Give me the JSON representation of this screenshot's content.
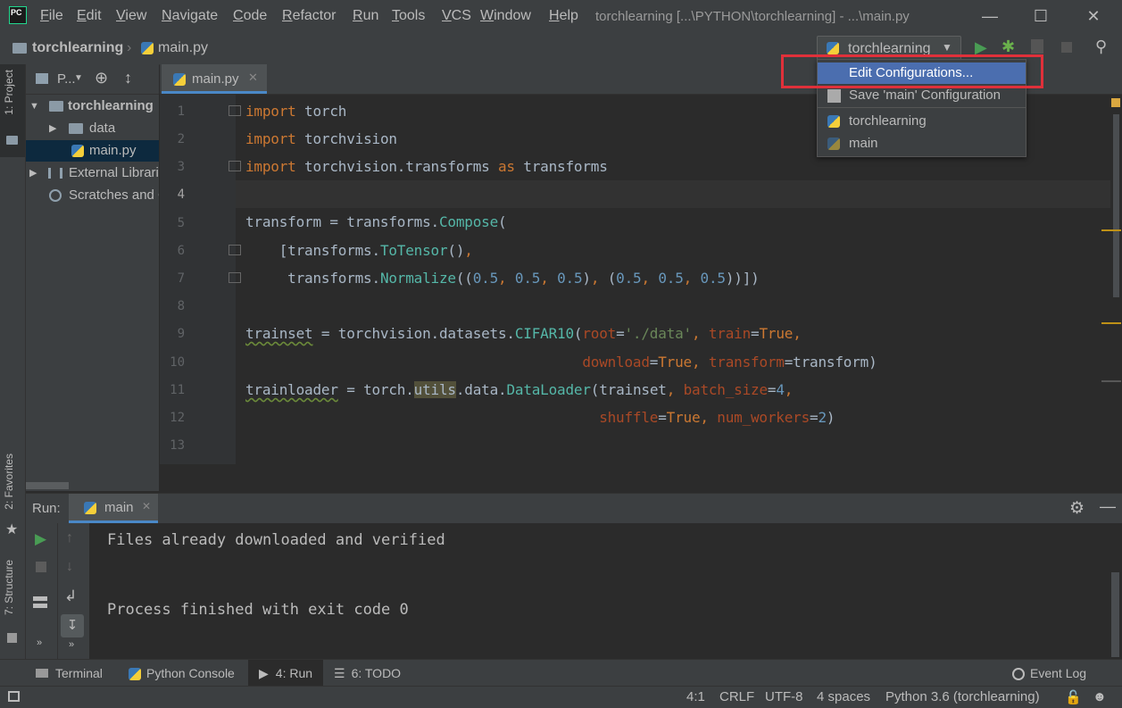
{
  "menu": {
    "items": [
      "File",
      "Edit",
      "View",
      "Navigate",
      "Code",
      "Refactor",
      "Run",
      "Tools",
      "VCS",
      "Window",
      "Help"
    ],
    "window_title": "torchlearning [...\\PYTHON\\torchlearning] - ...\\main.py"
  },
  "navbar": {
    "project": "torchlearning",
    "file": "main.py",
    "run_config": "torchlearning"
  },
  "project_panel": {
    "header": "P...",
    "tree": [
      "torchlearning",
      "data",
      "main.py",
      "External Libraries",
      "Scratches and Consoles"
    ]
  },
  "left_strip": {
    "project": "1: Project",
    "favorites": "2: Favorites",
    "structure": "7: Structure"
  },
  "editor": {
    "tab": "main.py",
    "line_numbers": [
      "1",
      "2",
      "3",
      "4",
      "5",
      "6",
      "7",
      "8",
      "9",
      "10",
      "11",
      "12",
      "13"
    ]
  },
  "popup": {
    "items": [
      "Edit Configurations...",
      "Save 'main' Configuration",
      "torchlearning",
      "main"
    ]
  },
  "run": {
    "label": "Run:",
    "tab": "main",
    "output": [
      "Files already downloaded and verified",
      "",
      "Process finished with exit code 0"
    ]
  },
  "bottom_tabs": [
    "Terminal",
    "Python Console",
    "4: Run",
    "6: TODO",
    "Event Log"
  ],
  "status": {
    "position": "4:1",
    "line_sep": "CRLF",
    "encoding": "UTF-8",
    "indent": "4 spaces",
    "interpreter": "Python 3.6 (torchlearning)"
  },
  "colors": {
    "accent": "#4b6eaf",
    "highlight": "#e0303a",
    "run_green": "#499c54"
  }
}
